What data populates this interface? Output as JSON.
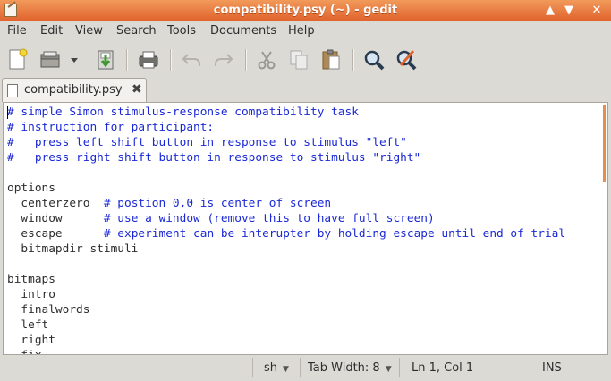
{
  "window": {
    "title": "compatibility.psy (~) - gedit"
  },
  "title_buttons": [
    "▲",
    "▼",
    "✕"
  ],
  "menu": [
    "File",
    "Edit",
    "View",
    "Search",
    "Tools",
    "Documents",
    "Help"
  ],
  "toolbar": {
    "icons": [
      "new-document-icon",
      "open-icon",
      "dropdown-arrow-icon",
      "save-icon",
      "print-icon",
      "undo-icon",
      "redo-icon",
      "cut-icon",
      "copy-icon",
      "paste-icon",
      "find-icon",
      "find-replace-icon"
    ]
  },
  "tab": {
    "label": "compatibility.psy",
    "close": "✖"
  },
  "editor": {
    "lines": [
      {
        "t": "# simple Simon stimulus-response compatibility task",
        "k": "c"
      },
      {
        "t": "# instruction for participant:",
        "k": "c"
      },
      {
        "t": "#   press left shift button in response to stimulus \"left\"",
        "k": "c"
      },
      {
        "t": "#   press right shift button in response to stimulus \"right\"",
        "k": "c"
      },
      {
        "t": "",
        "k": "p"
      },
      {
        "t": "options",
        "k": "p"
      },
      {
        "t": "  centerzero  ",
        "k": "p",
        "comment": "# postion 0,0 is center of screen"
      },
      {
        "t": "  window      ",
        "k": "p",
        "comment": "# use a window (remove this to have full screen)"
      },
      {
        "t": "  escape      ",
        "k": "p",
        "comment": "# experiment can be interupter by holding escape until end of trial"
      },
      {
        "t": "  bitmapdir stimuli",
        "k": "p"
      },
      {
        "t": "",
        "k": "p"
      },
      {
        "t": "bitmaps",
        "k": "p"
      },
      {
        "t": "  intro",
        "k": "p"
      },
      {
        "t": "  finalwords",
        "k": "p"
      },
      {
        "t": "  left",
        "k": "p"
      },
      {
        "t": "  right",
        "k": "p"
      },
      {
        "t": "  fix",
        "k": "p"
      }
    ]
  },
  "status": {
    "language": "sh",
    "tab_width": "Tab Width:  8",
    "position": "Ln 1, Col 1",
    "mode": "INS",
    "arrow": "▼"
  }
}
